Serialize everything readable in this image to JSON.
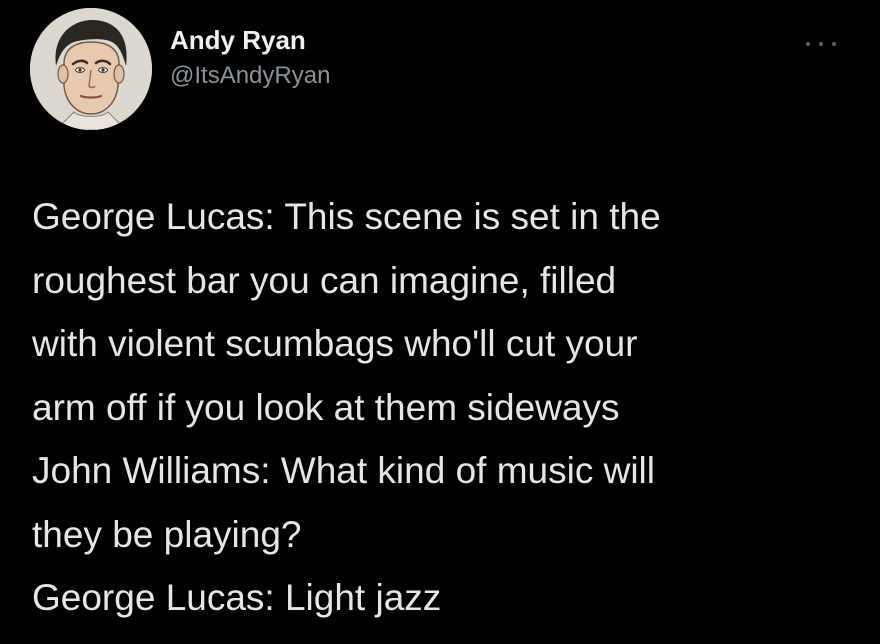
{
  "author": {
    "display_name": "Andy Ryan",
    "handle": "@ItsAndyRyan",
    "avatar_icon": "profile-photo"
  },
  "menu": {
    "icon": "more-horizontal-icon"
  },
  "tweet": {
    "lines": [
      "George Lucas: This scene is set in the",
      "roughest bar you can imagine, filled",
      "with violent scumbags who'll cut your",
      "arm off if you look at them sideways",
      "John Williams: What kind of music will",
      "they be playing?",
      "George Lucas: Light jazz"
    ]
  },
  "colors": {
    "background": "#000000",
    "text": "#e6e6e6",
    "handle": "#8b9299"
  }
}
